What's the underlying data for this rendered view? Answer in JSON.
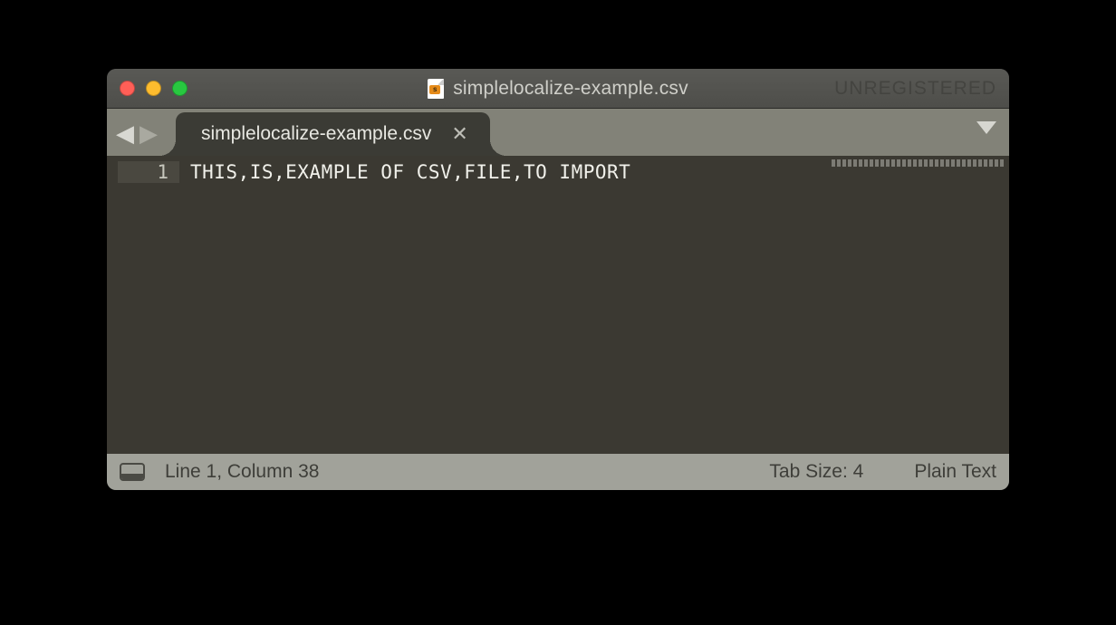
{
  "titlebar": {
    "filename": "simplelocalize-example.csv",
    "registration": "UNREGISTERED"
  },
  "tabs": {
    "active": {
      "label": "simplelocalize-example.csv"
    }
  },
  "editor": {
    "lines": [
      {
        "num": "1",
        "text": "THIS,IS,EXAMPLE OF CSV,FILE,TO IMPORT"
      }
    ]
  },
  "statusbar": {
    "position": "Line 1, Column 38",
    "tab_size": "Tab Size: 4",
    "syntax": "Plain Text"
  }
}
